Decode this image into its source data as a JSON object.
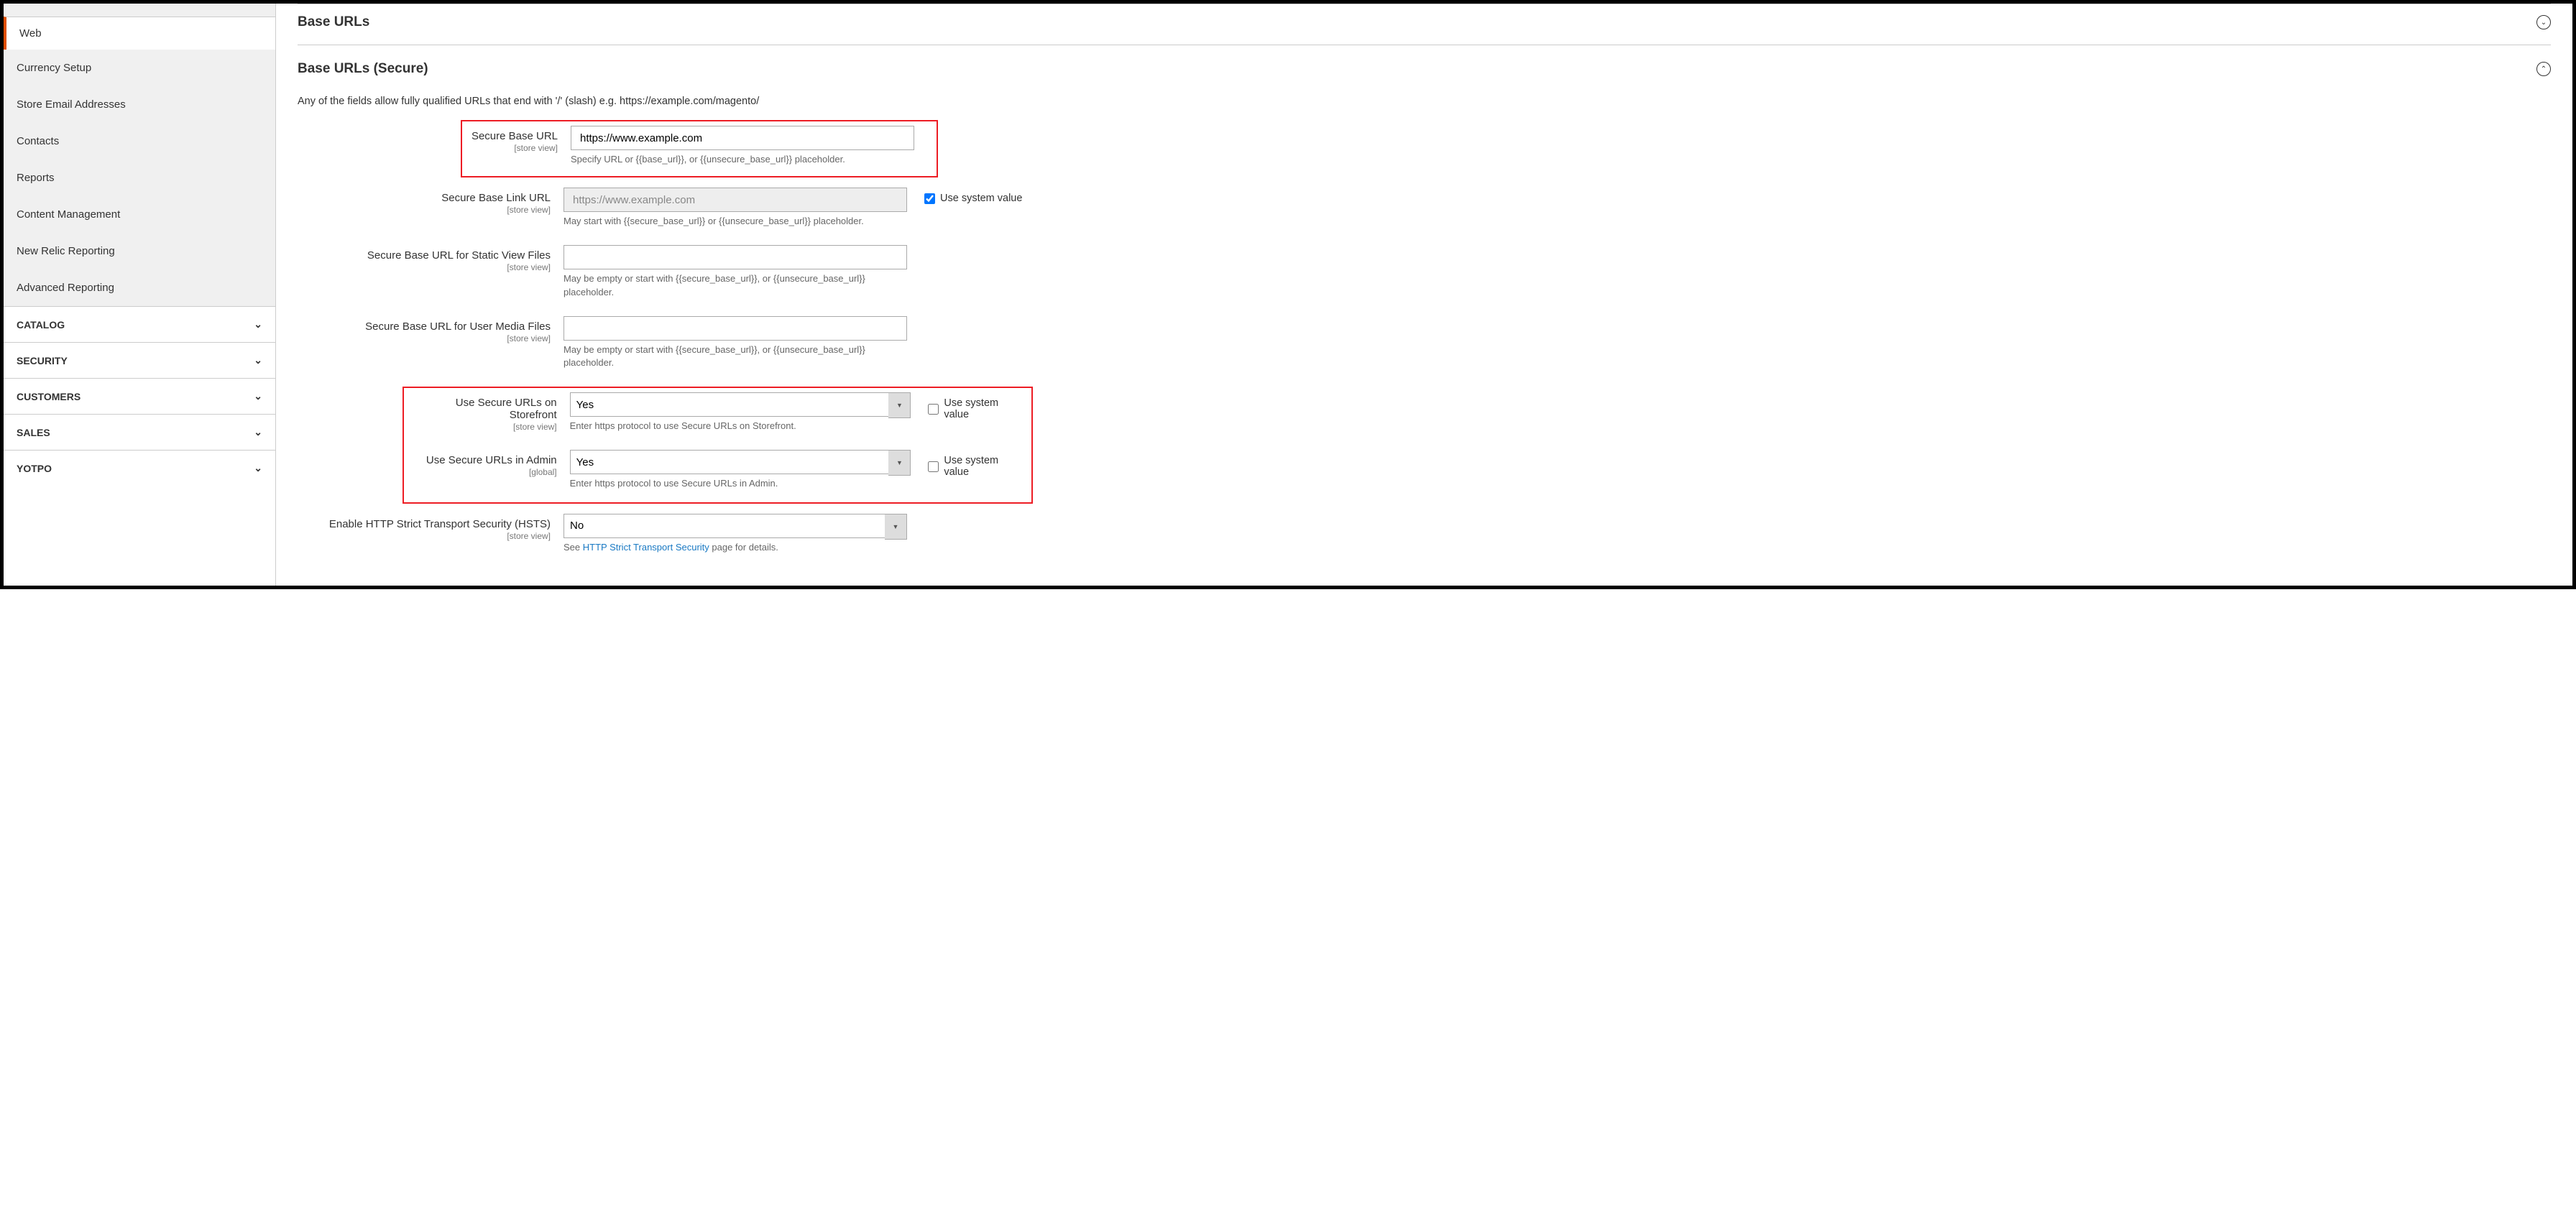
{
  "sidebar": {
    "active": "Web",
    "sub_items": [
      "Currency Setup",
      "Store Email Addresses",
      "Contacts",
      "Reports",
      "Content Management",
      "New Relic Reporting",
      "Advanced Reporting"
    ],
    "groups": [
      "CATALOG",
      "SECURITY",
      "CUSTOMERS",
      "SALES",
      "YOTPO"
    ]
  },
  "sections": {
    "base_urls_title": "Base URLs",
    "base_urls_secure_title": "Base URLs (Secure)",
    "secure_desc": "Any of the fields allow fully qualified URLs that end with '/' (slash) e.g. https://example.com/magento/"
  },
  "fields": {
    "secure_base_url": {
      "label": "Secure Base URL",
      "scope": "[store view]",
      "value": "https://www.example.com",
      "help": "Specify URL or {{base_url}}, or {{unsecure_base_url}} placeholder."
    },
    "secure_base_link_url": {
      "label": "Secure Base Link URL",
      "scope": "[store view]",
      "value": "https://www.example.com",
      "help": "May start with {{secure_base_url}} or {{unsecure_base_url}} placeholder.",
      "system_checked": true
    },
    "secure_base_static": {
      "label": "Secure Base URL for Static View Files",
      "scope": "[store view]",
      "value": "",
      "help": "May be empty or start with {{secure_base_url}}, or {{unsecure_base_url}} placeholder."
    },
    "secure_base_media": {
      "label": "Secure Base URL for User Media Files",
      "scope": "[store view]",
      "value": "",
      "help": "May be empty or start with {{secure_base_url}}, or {{unsecure_base_url}} placeholder."
    },
    "use_secure_storefront": {
      "label": "Use Secure URLs on Storefront",
      "scope": "[store view]",
      "value": "Yes",
      "help": "Enter https protocol to use Secure URLs on Storefront.",
      "system_checked": false
    },
    "use_secure_admin": {
      "label": "Use Secure URLs in Admin",
      "scope": "[global]",
      "value": "Yes",
      "help": "Enter https protocol to use Secure URLs in Admin.",
      "system_checked": false
    },
    "hsts": {
      "label": "Enable HTTP Strict Transport Security (HSTS)",
      "scope": "[store view]",
      "value": "No",
      "help_prefix": "See ",
      "help_link": "HTTP Strict Transport Security",
      "help_suffix": " page for details."
    }
  },
  "labels": {
    "use_system_value": "Use system value"
  }
}
